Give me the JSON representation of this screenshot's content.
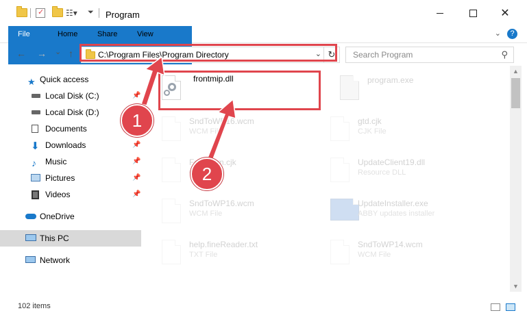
{
  "window": {
    "title": "Program",
    "minimize_icon": "minimize-icon",
    "maximize_icon": "maximize-icon",
    "close_icon": "close-icon",
    "close_glyph": "✕"
  },
  "ribbon": {
    "tabs": [
      {
        "label": "File"
      },
      {
        "label": "Home"
      },
      {
        "label": "Share"
      },
      {
        "label": "View"
      }
    ],
    "help_glyph": "?"
  },
  "navigation": {
    "back_glyph": "←",
    "forward_glyph": "→",
    "recent_glyph": "⌄",
    "up_glyph": "↑",
    "address": "C:\\Program Files\\Program Directory",
    "search_placeholder": "Search Program"
  },
  "sidebar": {
    "items": [
      {
        "label": "Quick access",
        "icon": "star-icon"
      },
      {
        "label": "Local Disk (C:)",
        "icon": "drive-icon",
        "pinned": true
      },
      {
        "label": "Local Disk (D:)",
        "icon": "drive-icon"
      },
      {
        "label": "Documents",
        "icon": "documents-icon",
        "pinned": true
      },
      {
        "label": "Downloads",
        "icon": "download-icon",
        "pinned": true
      },
      {
        "label": "Music",
        "icon": "music-icon",
        "pinned": true
      },
      {
        "label": "Pictures",
        "icon": "pictures-icon",
        "pinned": true
      },
      {
        "label": "Videos",
        "icon": "videos-icon",
        "pinned": true
      },
      {
        "label": "OneDrive",
        "icon": "cloud-icon"
      },
      {
        "label": "This PC",
        "icon": "computer-icon",
        "selected": true
      },
      {
        "label": "Network",
        "icon": "network-icon"
      }
    ]
  },
  "files": [
    {
      "name": "frontmip.dll",
      "type": ""
    },
    {
      "name": "program.exe",
      "type": ""
    },
    {
      "name": "SndToWP16.wcm",
      "type": "WCM File"
    },
    {
      "name": "gtd.cjk",
      "type": "CJK File"
    },
    {
      "name": "Frontcom.cjk",
      "type": "CJK File"
    },
    {
      "name": "UpdateClient19.dll",
      "type": "Resource DLL"
    },
    {
      "name": "SndToWP16.wcm",
      "type": "WCM File"
    },
    {
      "name": "UpdateInstaller.exe",
      "type": "ABBY updates installer"
    },
    {
      "name": "help.fineReader.txt",
      "type": "TXT File"
    },
    {
      "name": "SndToWP14.wcm",
      "type": "WCM File"
    }
  ],
  "annotations": {
    "step1": "1",
    "step2": "2",
    "highlight_color": "#e0454d"
  },
  "status": {
    "item_count": "102 items"
  },
  "colors": {
    "accent": "#1979ca"
  }
}
